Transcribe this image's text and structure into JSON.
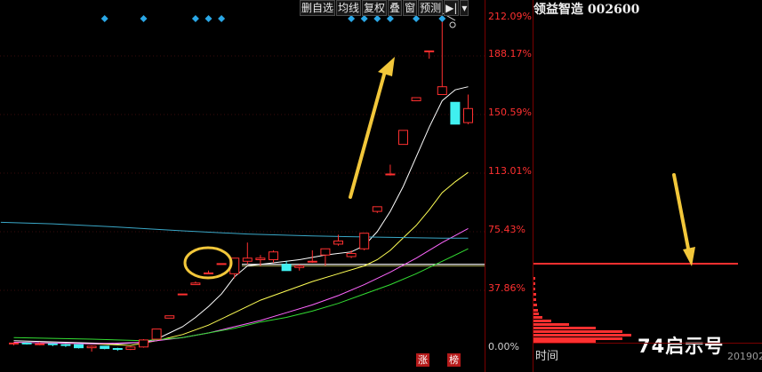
{
  "toolbar": {
    "buttons": [
      {
        "label": "删自选"
      },
      {
        "label": "均线"
      },
      {
        "label": "复权"
      },
      {
        "label": "叠"
      },
      {
        "label": "窗"
      },
      {
        "label": "预测"
      },
      {
        "label": "▶|"
      },
      {
        "label": "▾"
      }
    ]
  },
  "stock_title": "领益智造 002600",
  "panel": {
    "time_label": "时间",
    "brand": "74启示号",
    "date_partial": "201902"
  },
  "tags": [
    "涨",
    "榜"
  ],
  "colors": {
    "up": "#ff3030",
    "down": "#40f0f0",
    "diamond": "#2aa7e6",
    "annotation": "#f2c73a",
    "ma5": "#ffffff",
    "ma10": "#ffff55",
    "ma20": "#ff66ff",
    "ma30": "#33dd33",
    "ma_long": "#3aa8c8"
  },
  "chart_data": {
    "type": "candlestick",
    "y_axis_ticks": [
      "212.09%",
      "188.17%",
      "150.59%",
      "113.01%",
      "75.43%",
      "37.86%",
      "0.00%"
    ],
    "yscale": "percent change",
    "ylim": [
      -5,
      212.09
    ],
    "candles": [
      {
        "o": 2,
        "h": 3,
        "l": 1,
        "c": 2.5
      },
      {
        "o": 2.5,
        "h": 3,
        "l": 1.5,
        "c": 2
      },
      {
        "o": 2,
        "h": 3,
        "l": 1,
        "c": 2
      },
      {
        "o": 2,
        "h": 2.5,
        "l": 0.5,
        "c": 1.5
      },
      {
        "o": 1.5,
        "h": 2,
        "l": 0,
        "c": 1
      },
      {
        "o": 1.5,
        "h": 1.5,
        "l": -1,
        "c": -0.5
      },
      {
        "o": -0.5,
        "h": 1,
        "l": -3,
        "c": 0.5
      },
      {
        "o": 0.5,
        "h": 0.5,
        "l": -1.5,
        "c": -1
      },
      {
        "o": -1,
        "h": -0.5,
        "l": -2.5,
        "c": -1.5
      },
      {
        "o": -1.5,
        "h": 0.5,
        "l": -2,
        "c": 0
      },
      {
        "o": 0,
        "h": 5,
        "l": -0.5,
        "c": 4.5
      },
      {
        "o": 5,
        "h": 11.5,
        "l": 5,
        "c": 11.5
      },
      {
        "o": 18.5,
        "h": 20,
        "l": 18.5,
        "c": 20
      },
      {
        "o": 33.5,
        "h": 34,
        "l": 33.5,
        "c": 34
      },
      {
        "o": 40,
        "h": 42,
        "l": 40,
        "c": 41
      },
      {
        "o": 47,
        "h": 49,
        "l": 47,
        "c": 47.5
      },
      {
        "o": 53,
        "h": 53.5,
        "l": 53,
        "c": 53.5
      },
      {
        "o": 47,
        "h": 57,
        "l": 44,
        "c": 57
      },
      {
        "o": 55,
        "h": 67,
        "l": 53,
        "c": 57
      },
      {
        "o": 56,
        "h": 59,
        "l": 52,
        "c": 57
      },
      {
        "o": 56,
        "h": 62,
        "l": 54,
        "c": 61
      },
      {
        "o": 53,
        "h": 55,
        "l": 49,
        "c": 49
      },
      {
        "o": 51,
        "h": 53,
        "l": 49,
        "c": 52
      },
      {
        "o": 55,
        "h": 62,
        "l": 54,
        "c": 55
      },
      {
        "o": 59,
        "h": 63,
        "l": 52,
        "c": 63
      },
      {
        "o": 66,
        "h": 72,
        "l": 65,
        "c": 68
      },
      {
        "o": 58,
        "h": 62,
        "l": 57,
        "c": 60
      },
      {
        "o": 63,
        "h": 73,
        "l": 62,
        "c": 73
      },
      {
        "o": 87,
        "h": 90,
        "l": 86,
        "c": 90
      },
      {
        "o": 111,
        "h": 117,
        "l": 110,
        "c": 111
      },
      {
        "o": 130,
        "h": 139,
        "l": 130,
        "c": 139
      },
      {
        "o": 158,
        "h": 160,
        "l": 158,
        "c": 160
      },
      {
        "o": 190,
        "h": 190,
        "l": 185,
        "c": 190
      },
      {
        "o": 162,
        "h": 210,
        "l": 162,
        "c": 167
      },
      {
        "o": 157,
        "h": 157,
        "l": 143,
        "c": 143
      },
      {
        "o": 144,
        "h": 162,
        "l": 143,
        "c": 153
      }
    ],
    "moving_averages": [
      {
        "name": "MA5",
        "points": [
          [
            0,
            4
          ],
          [
            4,
            3
          ],
          [
            8,
            2
          ],
          [
            10,
            3
          ],
          [
            11,
            5
          ],
          [
            12,
            9
          ],
          [
            13,
            13
          ],
          [
            14,
            19
          ],
          [
            15,
            26
          ],
          [
            16,
            34
          ],
          [
            17,
            45
          ],
          [
            18,
            52
          ],
          [
            20,
            54
          ],
          [
            22,
            56
          ],
          [
            24,
            59
          ],
          [
            26,
            61
          ],
          [
            27,
            65
          ],
          [
            28,
            74
          ],
          [
            29,
            87
          ],
          [
            30,
            103
          ],
          [
            31,
            122
          ],
          [
            32,
            141
          ],
          [
            33,
            158
          ],
          [
            34,
            165
          ],
          [
            35,
            167
          ]
        ]
      },
      {
        "name": "MA10",
        "points": [
          [
            0,
            3
          ],
          [
            6,
            2
          ],
          [
            9,
            1
          ],
          [
            11,
            4
          ],
          [
            13,
            8
          ],
          [
            15,
            14
          ],
          [
            17,
            22
          ],
          [
            19,
            30
          ],
          [
            21,
            36
          ],
          [
            23,
            42
          ],
          [
            25,
            47
          ],
          [
            27,
            52
          ],
          [
            28,
            56
          ],
          [
            29,
            62
          ],
          [
            30,
            70
          ],
          [
            31,
            78
          ],
          [
            32,
            88
          ],
          [
            33,
            99
          ],
          [
            34,
            106
          ],
          [
            35,
            112
          ]
        ]
      },
      {
        "name": "MA20",
        "points": [
          [
            0,
            3
          ],
          [
            6,
            2
          ],
          [
            10,
            3
          ],
          [
            13,
            6
          ],
          [
            15,
            9
          ],
          [
            17,
            13
          ],
          [
            19,
            17
          ],
          [
            21,
            22
          ],
          [
            23,
            27
          ],
          [
            25,
            33
          ],
          [
            27,
            40
          ],
          [
            29,
            48
          ],
          [
            31,
            57
          ],
          [
            33,
            67
          ],
          [
            35,
            76
          ]
        ]
      },
      {
        "name": "MA30",
        "points": [
          [
            0,
            6
          ],
          [
            6,
            5
          ],
          [
            10,
            4
          ],
          [
            13,
            6
          ],
          [
            15,
            9
          ],
          [
            17,
            12
          ],
          [
            19,
            16
          ],
          [
            21,
            19
          ],
          [
            23,
            23
          ],
          [
            25,
            28
          ],
          [
            27,
            34
          ],
          [
            29,
            40
          ],
          [
            31,
            47
          ],
          [
            33,
            55
          ],
          [
            35,
            63
          ]
        ]
      },
      {
        "name": "MA_long",
        "points": [
          [
            -1,
            80
          ],
          [
            3,
            79
          ],
          [
            8,
            77
          ],
          [
            13,
            74.5
          ],
          [
            18,
            72.5
          ],
          [
            23,
            71.2
          ],
          [
            28,
            70.5
          ],
          [
            33,
            69.8
          ],
          [
            35,
            69.8
          ]
        ]
      }
    ],
    "reference_line": 53,
    "signal_markers": [
      7,
      10,
      14,
      15,
      16,
      26,
      27,
      28,
      29,
      31,
      33
    ]
  }
}
